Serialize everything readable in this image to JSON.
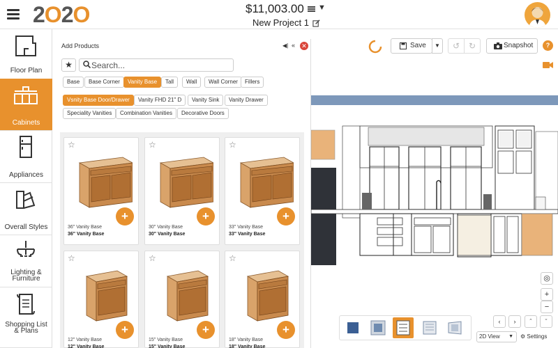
{
  "header": {
    "logo": {
      "p1": "2",
      "p2": "O",
      "p3": "2",
      "p4": "O"
    },
    "price": "$11,003.00",
    "project_name": "New Project 1"
  },
  "sidebar": {
    "items": [
      {
        "label": "Floor Plan",
        "icon": "floor-plan-icon"
      },
      {
        "label": "Cabinets",
        "icon": "cabinets-icon",
        "active": true
      },
      {
        "label": "Appliances",
        "icon": "appliances-icon"
      },
      {
        "label": "Overall Styles",
        "icon": "styles-icon"
      },
      {
        "label": "Lighting &",
        "label2": "Furniture",
        "icon": "lighting-icon"
      },
      {
        "label": "Shopping List",
        "label2": "& Plans",
        "icon": "shopping-list-icon"
      }
    ]
  },
  "panel": {
    "title": "Add Products",
    "search_placeholder": "Search...",
    "categories": [
      "Base",
      "Base Corner",
      "Vanity Base",
      "Tall",
      "Wall",
      "Wall Corner",
      "Fillers"
    ],
    "active_category": "Vanity Base",
    "subcategories": [
      "Vsnity Base Door/Drawer",
      "Vanity FHD 21\" D",
      "Vanity Sink",
      "Vanity Drawer",
      "Speciality Vanities",
      "Combination Vanities",
      "Decorative Doors"
    ],
    "active_subcategory": "Vsnity Base Door/Drawer",
    "products": [
      {
        "name": "36\" Vanity Base",
        "title": "36\" Vanity Base"
      },
      {
        "name": "30\" Vanity Base",
        "title": "30\" Vanity Base"
      },
      {
        "name": "33\" Vanity Base",
        "title": "33\" Vanity Base"
      },
      {
        "name": "12\" Vanity Base",
        "title": "12\" Vanity Base"
      },
      {
        "name": "15\" Vanity Base",
        "title": "15\" Vanity Base"
      },
      {
        "name": "18\" Vanity Base",
        "title": "18\" Vanity Base"
      }
    ]
  },
  "toolbar": {
    "save_label": "Save",
    "snapshot_label": "Snapshot",
    "help_label": "?"
  },
  "view": {
    "mode": "2D View",
    "settings_label": "Settings"
  },
  "colors": {
    "accent": "#e8912d",
    "wall_band": "#7d98ba",
    "close": "#d9453a"
  }
}
